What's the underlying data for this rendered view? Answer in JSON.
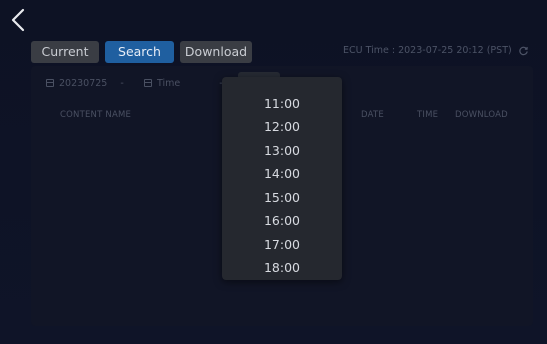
{
  "tabs": [
    {
      "label": "Current"
    },
    {
      "label": "Search"
    },
    {
      "label": "Download"
    }
  ],
  "active_tab": "Search",
  "ecu_time": "ECU Time : 2023-07-25 20:12 (PST)",
  "filters": {
    "date_value": "20230725",
    "date_separator": "-",
    "time_placeholder": "Time",
    "time_separator": "-"
  },
  "table": {
    "columns": [
      "CONTENT NAME",
      "DATE",
      "TIME",
      "DOWNLOAD"
    ],
    "rows": []
  },
  "time_dropdown": {
    "options": [
      "11:00",
      "12:00",
      "13:00",
      "14:00",
      "15:00",
      "16:00",
      "17:00",
      "18:00"
    ]
  },
  "icons": {
    "back": "chevron-left-icon",
    "refresh": "refresh-icon",
    "calendar": "calendar-icon"
  },
  "colors": {
    "background": "#0d1224",
    "active_tab": "#1f5fa0",
    "inactive_tab": "#3a3d44",
    "dropdown": "#25282f"
  }
}
